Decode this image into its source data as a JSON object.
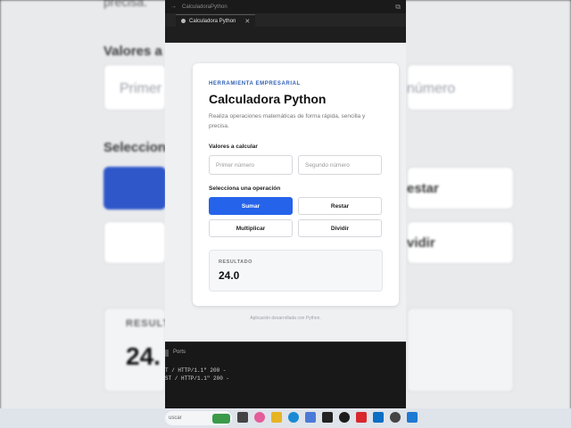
{
  "window": {
    "title": "CalculadoraPython"
  },
  "tab": {
    "label": "Calculadora Python"
  },
  "background": {
    "partial_desc": "precisa.",
    "values_label": "Valores a c",
    "first_placeholder": "Primer",
    "second_placeholder": "número",
    "select_label": "Selecciona",
    "restar": "estar",
    "dividir": "vidir",
    "result_label": "RESULT",
    "result_value": "24."
  },
  "app": {
    "eyebrow": "HERRAMIENTA EMPRESARIAL",
    "title": "Calculadora Python",
    "description": "Realiza operaciones matemáticas de forma rápida, sencilla y precisa.",
    "values_label": "Valores a calcular",
    "first_placeholder": "Primer número",
    "second_placeholder": "Segundo número",
    "operation_label": "Selecciona una operación",
    "buttons": {
      "sum": "Sumar",
      "subtract": "Restar",
      "multiply": "Multiplicar",
      "divide": "Dividir"
    },
    "result_label": "RESULTADO",
    "result_value": "24.0",
    "footer": "Aplicación desarrollada con Python."
  },
  "terminal": {
    "ports_tab": "Ports",
    "lines": [
      "T / HTTP/1.1\" 200 -",
      "ST / HTTP/1.1\" 200 -"
    ]
  },
  "taskbar": {
    "search_placeholder": "uscar"
  },
  "colors": {
    "accent": "#2563eb",
    "eyebrow": "#2f5fb5"
  }
}
